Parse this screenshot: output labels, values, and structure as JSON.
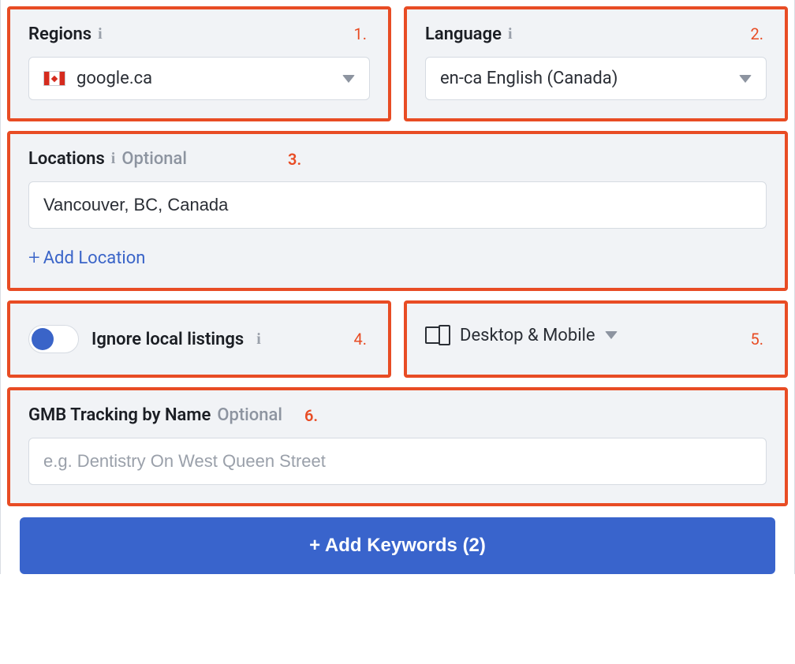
{
  "regions": {
    "label": "Regions",
    "annot": "1.",
    "selected": "google.ca"
  },
  "language": {
    "label": "Language",
    "annot": "2.",
    "selected": "en-ca English (Canada)"
  },
  "locations": {
    "label": "Locations",
    "optional": "Optional",
    "annot": "3.",
    "value": "Vancouver, BC, Canada",
    "add_label": "Add Location"
  },
  "ignore": {
    "label": "Ignore local listings",
    "annot": "4."
  },
  "device": {
    "label": "Desktop & Mobile",
    "annot": "5."
  },
  "gmb": {
    "label": "GMB Tracking by Name",
    "optional": "Optional",
    "annot": "6.",
    "placeholder": "e.g. Dentistry On West Queen Street"
  },
  "submit": {
    "label": "+ Add Keywords (2)"
  }
}
